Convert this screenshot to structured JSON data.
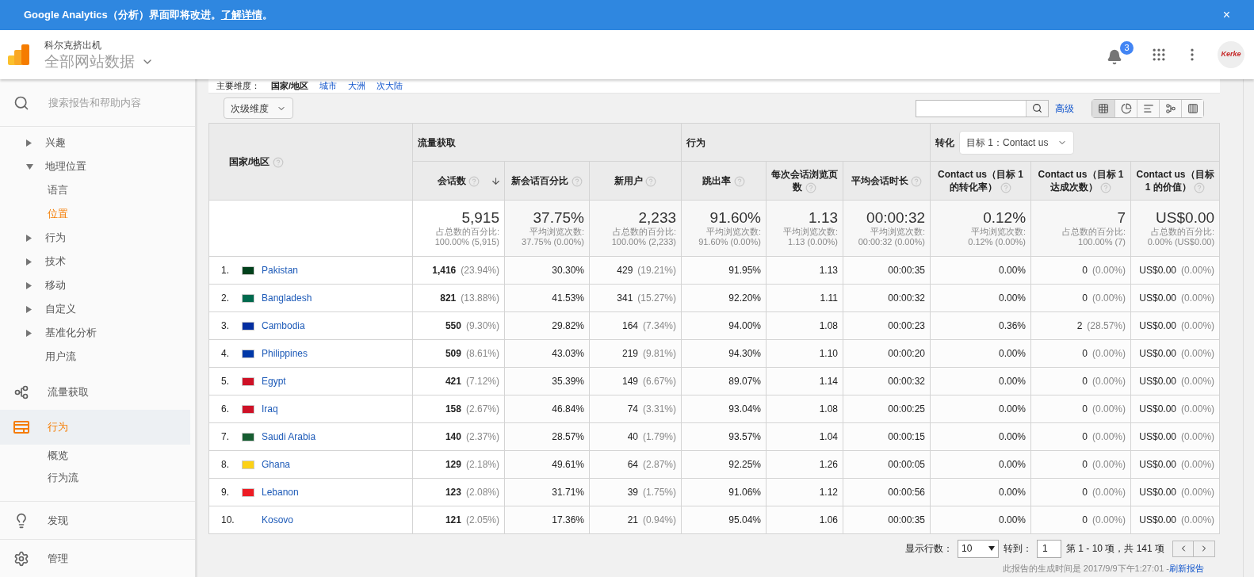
{
  "banner": {
    "text": "Google Analytics（分析）界面即将改进。",
    "link": "了解详情",
    "tail": "。",
    "close": "×"
  },
  "header": {
    "account": "科尔克挤出机",
    "property": "全部网站数据",
    "notifications": "3",
    "avatar_logo": "Kerke"
  },
  "sidebar": {
    "search_placeholder": "搜索报告和帮助内容",
    "tree": [
      {
        "label": "兴趣",
        "kind": "group",
        "expanded": false,
        "selected": false
      },
      {
        "label": "地理位置",
        "kind": "group",
        "expanded": true,
        "selected": false,
        "children": [
          {
            "label": "语言",
            "selected": false
          },
          {
            "label": "位置",
            "selected": true
          }
        ]
      },
      {
        "label": "行为",
        "kind": "group",
        "expanded": false,
        "selected": false
      },
      {
        "label": "技术",
        "kind": "group",
        "expanded": false,
        "selected": false
      },
      {
        "label": "移动",
        "kind": "group",
        "expanded": false,
        "selected": false
      },
      {
        "label": "自定义",
        "kind": "group",
        "expanded": false,
        "selected": false
      },
      {
        "label": "基准化分析",
        "kind": "group",
        "expanded": false,
        "selected": false
      },
      {
        "label": "用户流",
        "kind": "leaf",
        "selected": false
      }
    ],
    "sections": [
      {
        "label": "流量获取",
        "kind": "acquisition",
        "selected": false
      },
      {
        "label": "行为",
        "kind": "behavior",
        "selected": true,
        "children": [
          {
            "label": "概览",
            "selected": false
          },
          {
            "label": "行为流",
            "selected": false
          }
        ]
      }
    ],
    "bottom": [
      {
        "label": "发现",
        "kind": "discover"
      },
      {
        "label": "管理",
        "kind": "admin"
      }
    ]
  },
  "report": {
    "primary_label": "主要维度：",
    "primary_dimensions": [
      {
        "label": "国家/地区",
        "selected": true
      },
      {
        "label": "城市",
        "selected": false
      },
      {
        "label": "大洲",
        "selected": false
      },
      {
        "label": "次大陆",
        "selected": false
      }
    ],
    "secondary_dimension": "次级维度",
    "advanced": "高级",
    "views": [
      {
        "kind": "table",
        "selected": true
      },
      {
        "kind": "pie",
        "selected": false
      },
      {
        "kind": "performance",
        "selected": false
      },
      {
        "kind": "comparison",
        "selected": false
      },
      {
        "kind": "pivot",
        "selected": false
      }
    ],
    "table": {
      "dimension_column": "国家/地区",
      "groups": [
        {
          "label": "流量获取"
        },
        {
          "label": "行为"
        },
        {
          "label": "转化",
          "goal": "目标 1：Contact us"
        }
      ],
      "columns": [
        {
          "label": "会话数",
          "sorted": true
        },
        {
          "label": "新会话百分比",
          "sorted": false
        },
        {
          "label": "新用户",
          "sorted": false
        },
        {
          "label": "跳出率",
          "sorted": false
        },
        {
          "label": "每次会话浏览页数",
          "sorted": false
        },
        {
          "label": "平均会话时长",
          "sorted": false
        },
        {
          "label": "Contact us（目标 1 的转化率）",
          "sorted": false
        },
        {
          "label": "Contact us（目标 1 达成次数）",
          "sorted": false
        },
        {
          "label": "Contact us（目标 1 的价值）",
          "sorted": false
        }
      ],
      "totals": [
        {
          "value": "5,915",
          "caption": "占总数的百分比:",
          "detail": "100.00% (5,915)"
        },
        {
          "value": "37.75%",
          "caption": "平均浏览次数:",
          "detail": "37.75% (0.00%)"
        },
        {
          "value": "2,233",
          "caption": "占总数的百分比:",
          "detail": "100.00% (2,233)"
        },
        {
          "value": "91.60%",
          "caption": "平均浏览次数:",
          "detail": "91.60% (0.00%)"
        },
        {
          "value": "1.13",
          "caption": "平均浏览次数:",
          "detail": "1.13 (0.00%)"
        },
        {
          "value": "00:00:32",
          "caption": "平均浏览次数:",
          "detail": "00:00:32 (0.00%)"
        },
        {
          "value": "0.12%",
          "caption": "平均浏览次数:",
          "detail": "0.12% (0.00%)"
        },
        {
          "value": "7",
          "caption": "占总数的百分比:",
          "detail": "100.00% (7)"
        },
        {
          "value": "US$0.00",
          "caption": "占总数的百分比:",
          "detail": "0.00% (US$0.00)"
        }
      ],
      "rows": [
        {
          "rank": "1.",
          "country": "Pakistan",
          "color": "#01411c",
          "cells": [
            {
              "value": "1,416",
              "share": "(23.94%)"
            },
            {
              "value": "30.30%"
            },
            {
              "value": "429",
              "share": "(19.21%)"
            },
            {
              "value": "91.95%"
            },
            {
              "value": "1.13"
            },
            {
              "value": "00:00:35"
            },
            {
              "value": "0.00%"
            },
            {
              "value": "0",
              "share": "(0.00%)"
            },
            {
              "value": "US$0.00",
              "share": "(0.00%)"
            }
          ]
        },
        {
          "rank": "2.",
          "country": "Bangladesh",
          "color": "#006a4e",
          "cells": [
            {
              "value": "821",
              "share": "(13.88%)"
            },
            {
              "value": "41.53%"
            },
            {
              "value": "341",
              "share": "(15.27%)"
            },
            {
              "value": "92.20%"
            },
            {
              "value": "1.11"
            },
            {
              "value": "00:00:32"
            },
            {
              "value": "0.00%"
            },
            {
              "value": "0",
              "share": "(0.00%)"
            },
            {
              "value": "US$0.00",
              "share": "(0.00%)"
            }
          ]
        },
        {
          "rank": "3.",
          "country": "Cambodia",
          "color": "#032ea1",
          "cells": [
            {
              "value": "550",
              "share": "(9.30%)"
            },
            {
              "value": "29.82%"
            },
            {
              "value": "164",
              "share": "(7.34%)"
            },
            {
              "value": "94.00%"
            },
            {
              "value": "1.08"
            },
            {
              "value": "00:00:23"
            },
            {
              "value": "0.36%"
            },
            {
              "value": "2",
              "share": "(28.57%)"
            },
            {
              "value": "US$0.00",
              "share": "(0.00%)"
            }
          ]
        },
        {
          "rank": "4.",
          "country": "Philippines",
          "color": "#0038a8",
          "cells": [
            {
              "value": "509",
              "share": "(8.61%)"
            },
            {
              "value": "43.03%"
            },
            {
              "value": "219",
              "share": "(9.81%)"
            },
            {
              "value": "94.30%"
            },
            {
              "value": "1.10"
            },
            {
              "value": "00:00:20"
            },
            {
              "value": "0.00%"
            },
            {
              "value": "0",
              "share": "(0.00%)"
            },
            {
              "value": "US$0.00",
              "share": "(0.00%)"
            }
          ]
        },
        {
          "rank": "5.",
          "country": "Egypt",
          "color": "#ce1126",
          "cells": [
            {
              "value": "421",
              "share": "(7.12%)"
            },
            {
              "value": "35.39%"
            },
            {
              "value": "149",
              "share": "(6.67%)"
            },
            {
              "value": "89.07%"
            },
            {
              "value": "1.14"
            },
            {
              "value": "00:00:32"
            },
            {
              "value": "0.00%"
            },
            {
              "value": "0",
              "share": "(0.00%)"
            },
            {
              "value": "US$0.00",
              "share": "(0.00%)"
            }
          ]
        },
        {
          "rank": "6.",
          "country": "Iraq",
          "color": "#ce1127",
          "cells": [
            {
              "value": "158",
              "share": "(2.67%)"
            },
            {
              "value": "46.84%"
            },
            {
              "value": "74",
              "share": "(3.31%)"
            },
            {
              "value": "93.04%"
            },
            {
              "value": "1.08"
            },
            {
              "value": "00:00:25"
            },
            {
              "value": "0.00%"
            },
            {
              "value": "0",
              "share": "(0.00%)"
            },
            {
              "value": "US$0.00",
              "share": "(0.00%)"
            }
          ]
        },
        {
          "rank": "7.",
          "country": "Saudi Arabia",
          "color": "#165d31",
          "cells": [
            {
              "value": "140",
              "share": "(2.37%)"
            },
            {
              "value": "28.57%"
            },
            {
              "value": "40",
              "share": "(1.79%)"
            },
            {
              "value": "93.57%"
            },
            {
              "value": "1.04"
            },
            {
              "value": "00:00:15"
            },
            {
              "value": "0.00%"
            },
            {
              "value": "0",
              "share": "(0.00%)"
            },
            {
              "value": "US$0.00",
              "share": "(0.00%)"
            }
          ]
        },
        {
          "rank": "8.",
          "country": "Ghana",
          "color": "#fcd116",
          "cells": [
            {
              "value": "129",
              "share": "(2.18%)"
            },
            {
              "value": "49.61%"
            },
            {
              "value": "64",
              "share": "(2.87%)"
            },
            {
              "value": "92.25%"
            },
            {
              "value": "1.26"
            },
            {
              "value": "00:00:05"
            },
            {
              "value": "0.00%"
            },
            {
              "value": "0",
              "share": "(0.00%)"
            },
            {
              "value": "US$0.00",
              "share": "(0.00%)"
            }
          ]
        },
        {
          "rank": "9.",
          "country": "Lebanon",
          "color": "#ed1c24",
          "cells": [
            {
              "value": "123",
              "share": "(2.08%)"
            },
            {
              "value": "31.71%"
            },
            {
              "value": "39",
              "share": "(1.75%)"
            },
            {
              "value": "91.06%"
            },
            {
              "value": "1.12"
            },
            {
              "value": "00:00:56"
            },
            {
              "value": "0.00%"
            },
            {
              "value": "0",
              "share": "(0.00%)"
            },
            {
              "value": "US$0.00",
              "share": "(0.00%)"
            }
          ]
        },
        {
          "rank": "10.",
          "country": "Kosovo",
          "cells": [
            {
              "value": "121",
              "share": "(2.05%)"
            },
            {
              "value": "17.36%"
            },
            {
              "value": "21",
              "share": "(0.94%)"
            },
            {
              "value": "95.04%"
            },
            {
              "value": "1.06"
            },
            {
              "value": "00:00:35"
            },
            {
              "value": "0.00%"
            },
            {
              "value": "0",
              "share": "(0.00%)"
            },
            {
              "value": "US$0.00",
              "share": "(0.00%)"
            }
          ]
        }
      ]
    },
    "pagination": {
      "rows_label": "显示行数：",
      "rows_value": "10",
      "goto_label": "转到：",
      "goto_value": "1",
      "range": "第 1 - 10 项，共 141 项"
    },
    "footer": {
      "text": "此报告的生成时间是 2017/9/9下午1:27:01 - ",
      "link": "刷新报告"
    }
  }
}
